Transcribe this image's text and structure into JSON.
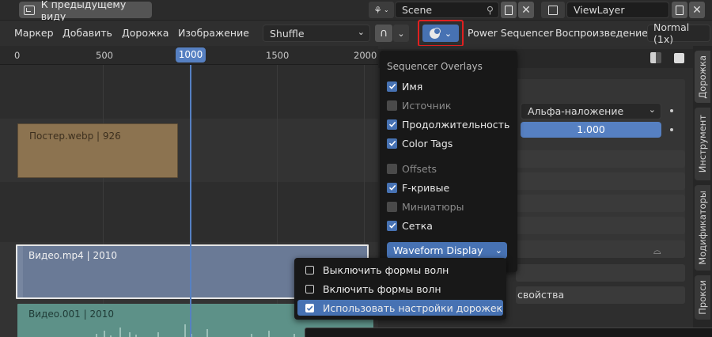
{
  "topbar": {
    "back_label": "К предыдущему виду",
    "scene": "Scene",
    "viewlayer": "ViewLayer"
  },
  "menubar": {
    "items": [
      "Маркер",
      "Добавить",
      "Дорожка",
      "Изображение"
    ],
    "shuffle": "Shuffle",
    "power_sequencer": "Power Sequencer",
    "playback_label": "Воспроизведение:",
    "playback_value": "Normal (1x)"
  },
  "ruler": {
    "ticks": [
      "0",
      "500",
      "1000",
      "1500",
      "2000"
    ],
    "current_frame": "1000"
  },
  "strips": {
    "poster": "Постер.webp | 926",
    "video": "Видео.mp4 | 2010",
    "video001": "Видео.001 | 2010"
  },
  "overlay_popup": {
    "title": "Sequencer Overlays",
    "options": [
      {
        "label": "Имя",
        "checked": true
      },
      {
        "label": "Источник",
        "checked": false
      },
      {
        "label": "Продолжительность",
        "checked": true
      },
      {
        "label": "Color Tags",
        "checked": true
      },
      {
        "label": "Offsets",
        "checked": false
      },
      {
        "label": "F-кривые",
        "checked": true
      },
      {
        "label": "Миниатюры",
        "checked": false
      },
      {
        "label": "Сетка",
        "checked": true
      }
    ],
    "waveform_button": "Waveform Display"
  },
  "waveform_menu": {
    "options": [
      {
        "label": "Выключить формы волн",
        "checked": false
      },
      {
        "label": "Включить формы волн",
        "checked": false
      },
      {
        "label": "Использовать настройки дорожек",
        "checked": true
      }
    ]
  },
  "right_panel": {
    "blend_mode": "Альфа-наложение",
    "opacity": "1.000",
    "properties_fragment": "свойства"
  },
  "side_tabs": [
    "Дорожка",
    "Инструмент",
    "Модификаторы",
    "Прокси"
  ],
  "colors": {
    "accent": "#4772b3",
    "playhead": "#5680c2",
    "poster_strip": "#8c7350",
    "video_strip": "#6a7a96",
    "audio_strip": "#5d9188",
    "highlight_box": "#e02020"
  }
}
